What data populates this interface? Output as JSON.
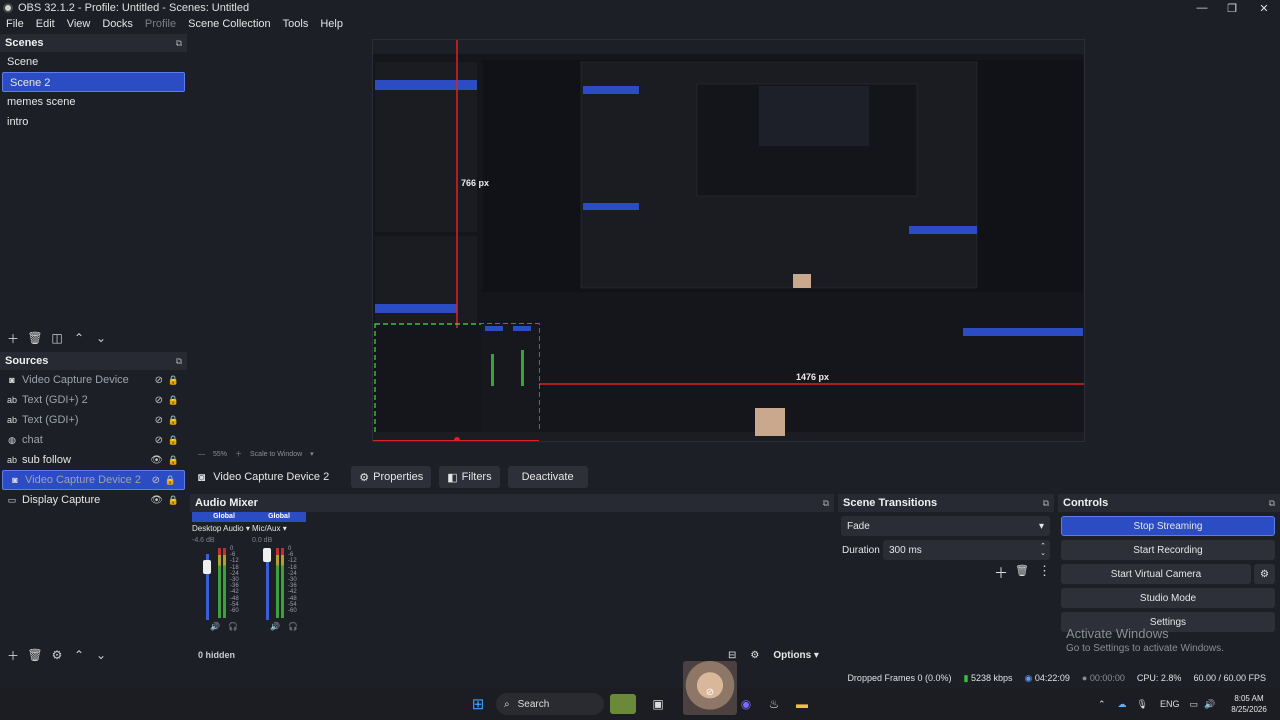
{
  "window": {
    "title": "OBS 32.1.2 - Profile: Untitled - Scenes: Untitled"
  },
  "menu": [
    "File",
    "Edit",
    "View",
    "Docks",
    "Profile",
    "Scene Collection",
    "Tools",
    "Help"
  ],
  "scenes": {
    "title": "Scenes",
    "items": [
      "Scene",
      "Scene 2",
      "memes scene",
      "intro"
    ],
    "selected": "Scene 2"
  },
  "sources": {
    "title": "Sources",
    "items": [
      {
        "name": "Video Capture Device",
        "icon": "camera-icon",
        "visible": false
      },
      {
        "name": "Text (GDI+) 2",
        "icon": "text-icon",
        "visible": false
      },
      {
        "name": "Text (GDI+)",
        "icon": "text-icon",
        "visible": false
      },
      {
        "name": "chat",
        "icon": "globe-icon",
        "visible": false
      },
      {
        "name": "sub follow",
        "icon": "text-icon",
        "visible": true
      },
      {
        "name": "Video Capture Device 2",
        "icon": "camera-icon",
        "visible": false
      },
      {
        "name": "Display Capture",
        "icon": "monitor-icon",
        "visible": true
      }
    ],
    "selected": "Video Capture Device 2"
  },
  "preview": {
    "measure_vertical": "766 px",
    "measure_horizontal": "1476 px",
    "zoom": "55%",
    "scale_mode": "Scale to Window"
  },
  "context_bar": {
    "source": "Video Capture Device 2",
    "properties": "Properties",
    "filters": "Filters",
    "deactivate": "Deactivate"
  },
  "audio_mixer": {
    "title": "Audio Mixer",
    "channels": [
      {
        "tag": "Global",
        "name": "Desktop Audio",
        "db": "-4.6 dB",
        "level": 0.82
      },
      {
        "tag": "Global",
        "name": "Mic/Aux",
        "db": "0.0 dB",
        "level": 0.9
      }
    ],
    "scale": [
      "0",
      "-6",
      "-12",
      "-18",
      "-24",
      "-30",
      "-36",
      "-42",
      "-48",
      "-54",
      "-60"
    ],
    "hidden": "0 hidden",
    "options": "Options"
  },
  "transitions": {
    "title": "Scene Transitions",
    "type": "Fade",
    "duration_label": "Duration",
    "duration": "300 ms"
  },
  "controls": {
    "title": "Controls",
    "stop_streaming": "Stop Streaming",
    "start_recording": "Start Recording",
    "start_virtual_camera": "Start Virtual Camera",
    "studio_mode": "Studio Mode",
    "settings": "Settings"
  },
  "watermark": {
    "line1": "Activate Windows",
    "line2": "Go to Settings to activate Windows."
  },
  "status": {
    "dropped_frames": "Dropped Frames 0 (0.0%)",
    "bitrate": "5238 kbps",
    "stream_time": "04:22:09",
    "record_time": "00:00:00",
    "cpu": "CPU: 2.8%",
    "fps": "60.00 / 60.00 FPS"
  },
  "taskbar": {
    "search": "Search",
    "lang": "ENG",
    "time": "8:05 AM",
    "date": "8/25/2026"
  },
  "colors": {
    "accent": "#2c4cc4",
    "background": "#1d1f26",
    "panel_header": "#272a33",
    "guide_red": "#e02020",
    "selection_green": "#40e040"
  }
}
